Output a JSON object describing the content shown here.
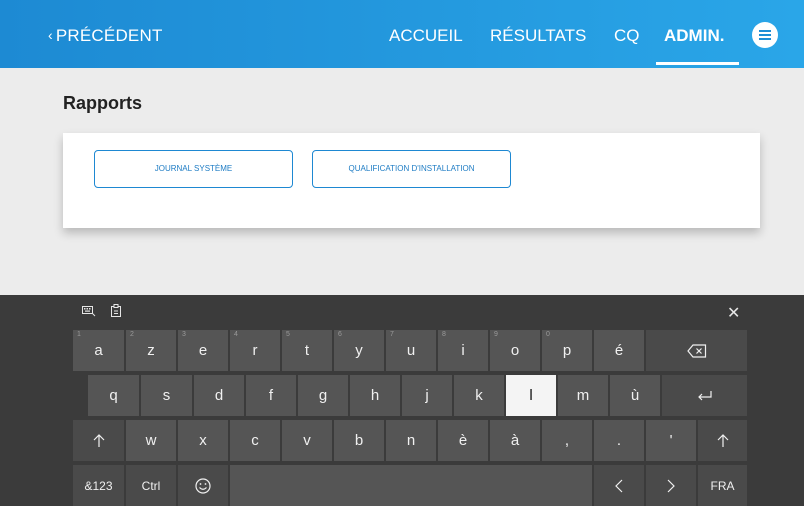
{
  "nav": {
    "back_label": "PRÉCÉDENT",
    "items": [
      {
        "label": "ACCUEIL"
      },
      {
        "label": "RÉSULTATS"
      },
      {
        "label": "CQ"
      },
      {
        "label": "ADMIN."
      }
    ]
  },
  "content": {
    "title": "Rapports",
    "buttons": [
      {
        "label": "JOURNAL SYSTÈME"
      },
      {
        "label": "QUALIFICATION D'INSTALLATION"
      }
    ]
  },
  "keyboard": {
    "row1": [
      {
        "label": "a",
        "num": "1"
      },
      {
        "label": "z",
        "num": "2"
      },
      {
        "label": "e",
        "num": "3"
      },
      {
        "label": "r",
        "num": "4"
      },
      {
        "label": "t",
        "num": "5"
      },
      {
        "label": "y",
        "num": "6"
      },
      {
        "label": "u",
        "num": "7"
      },
      {
        "label": "i",
        "num": "8"
      },
      {
        "label": "o",
        "num": "9"
      },
      {
        "label": "p",
        "num": "0"
      },
      {
        "label": "é",
        "num": ""
      }
    ],
    "row2": [
      "q",
      "s",
      "d",
      "f",
      "g",
      "h",
      "j",
      "k",
      "l",
      "m",
      "ù"
    ],
    "row3": [
      "w",
      "x",
      "c",
      "v",
      "b",
      "n",
      "è",
      "à",
      ",",
      ".",
      "'"
    ],
    "symbols_label": "&123",
    "ctrl_label": "Ctrl",
    "lang_label": "FRA"
  },
  "colors": {
    "topbar": "#1d8ad3",
    "accent": "#1e88d2",
    "keyboard_bg": "#3b3b3b",
    "key_bg": "#555555"
  }
}
